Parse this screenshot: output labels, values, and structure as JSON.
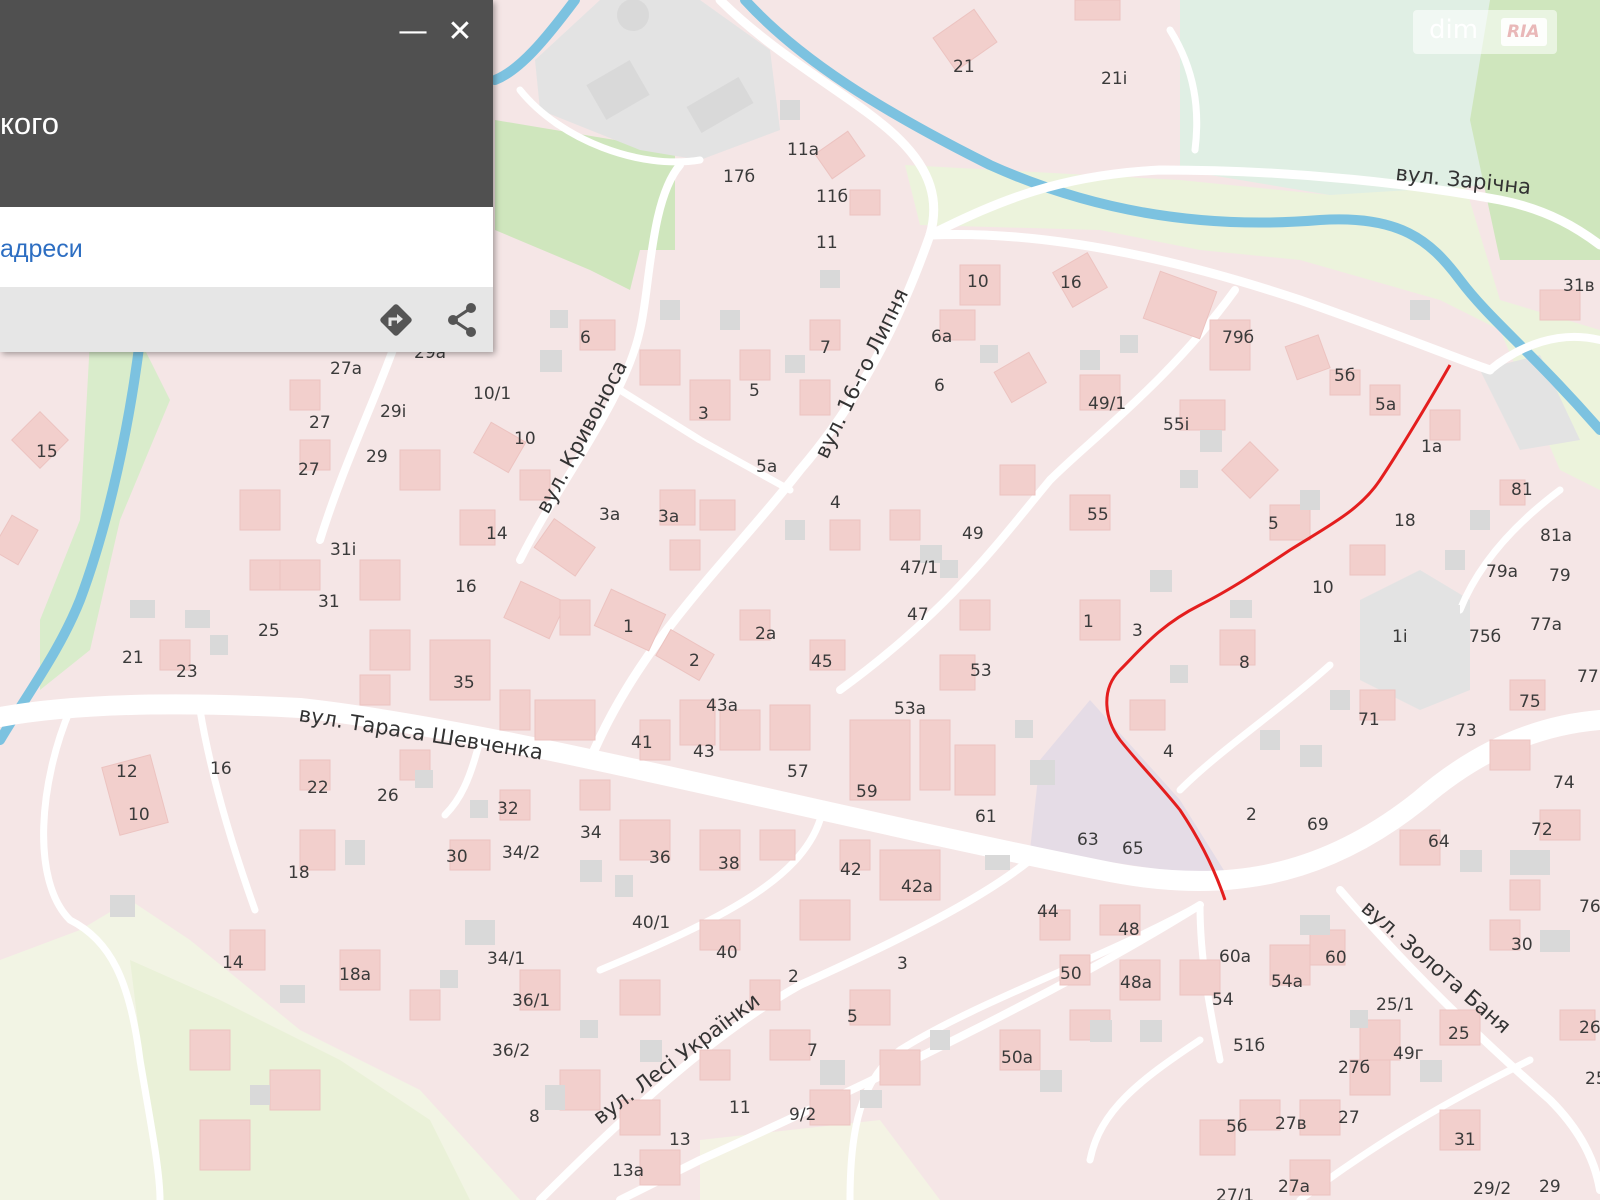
{
  "panel": {
    "title": "кого",
    "link": "адреси",
    "minimize": "—",
    "close": "✕"
  },
  "logo": {
    "text": "dim",
    "badge": "RIA"
  },
  "streets": {
    "shevchenka": "вул. Тараса Шевченка",
    "lypnia": "вул. 16-го Липня",
    "kryvonosa": "вул. Кривоноса",
    "zarichna": "вул. Зарічна",
    "zolota": "вул. Золота Баня",
    "lesi": "вул. Лесі Українки"
  },
  "houses": [
    "21",
    "21і",
    "11а",
    "17б",
    "11б",
    "11",
    "10",
    "16",
    "31в",
    "27а",
    "29а",
    "29і",
    "10/1",
    "6",
    "3",
    "5",
    "7",
    "6а",
    "6",
    "79б",
    "5б",
    "5а",
    "1а",
    "15",
    "27",
    "29",
    "27",
    "10",
    "3а",
    "3а",
    "5а",
    "4",
    "49/1",
    "55і",
    "55",
    "49",
    "5",
    "18",
    "81",
    "81а",
    "31і",
    "14",
    "16",
    "1",
    "47/1",
    "47",
    "10",
    "79а",
    "79",
    "31",
    "25",
    "2а",
    "2",
    "45",
    "53",
    "1",
    "3",
    "8",
    "1і",
    "75б",
    "77а",
    "77",
    "21",
    "23",
    "35",
    "43а",
    "53а",
    "71",
    "75",
    "73",
    "12",
    "16",
    "22",
    "26",
    "10",
    "41",
    "43",
    "57",
    "59",
    "61",
    "63",
    "65",
    "4",
    "2",
    "69",
    "74",
    "72",
    "64",
    "76",
    "32",
    "34",
    "34/2",
    "36",
    "38",
    "42",
    "42а",
    "18",
    "30",
    "44",
    "48",
    "60а",
    "60",
    "30",
    "40/1",
    "40",
    "34/1",
    "2",
    "3",
    "14",
    "18а",
    "50",
    "48а",
    "54",
    "54а",
    "25/1",
    "26",
    "36/1",
    "5",
    "51б",
    "27б",
    "25",
    "49г",
    "7",
    "36/2",
    "50а",
    "8",
    "11",
    "9/2",
    "13",
    "13а",
    "5б",
    "27в",
    "27",
    "31",
    "27/1",
    "27а",
    "29/2",
    "29",
    "25"
  ]
}
